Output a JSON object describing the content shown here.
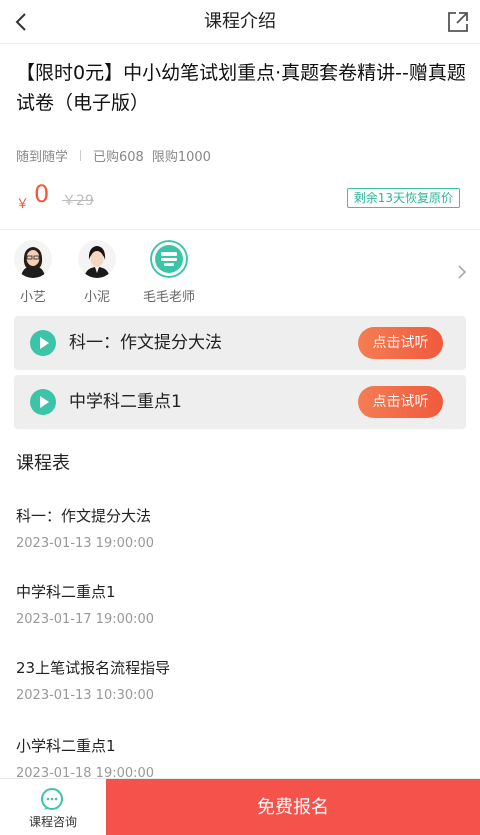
{
  "header": {
    "title": "课程介绍",
    "back_icon": "chevron-left-icon",
    "share_icon": "share-icon"
  },
  "course": {
    "title": "【限时0元】中小幼笔试划重点·真题套卷精讲--赠真题试卷（电子版）",
    "mode": "随到随学",
    "purchased": "已购608",
    "limit": "限购1000",
    "currency": "￥",
    "price": "0",
    "original_price": "￥29",
    "restore_badge": "剩余13天恢复原价"
  },
  "teachers": [
    {
      "name": "小艺"
    },
    {
      "name": "小泥"
    },
    {
      "name": "毛毛老师"
    }
  ],
  "trials": [
    {
      "label": "科一：作文提分大法",
      "button": "点击试听"
    },
    {
      "label": "中学科二重点1",
      "button": "点击试听"
    }
  ],
  "schedule": {
    "heading": "课程表",
    "items": [
      {
        "name": "科一：作文提分大法",
        "time": "2023-01-13 19:00:00"
      },
      {
        "name": "中学科二重点1",
        "time": "2023-01-17 19:00:00"
      },
      {
        "name": "23上笔试报名流程指导",
        "time": "2023-01-13 10:30:00"
      },
      {
        "name": "小学科二重点1",
        "time": "2023-01-18 19:00:00"
      }
    ]
  },
  "bottom": {
    "consult_label": "课程咨询",
    "signup_label": "免费报名"
  },
  "colors": {
    "accent_red": "#f05a3c",
    "accent_green": "#3cc4a9",
    "signup_bg": "#f5524c"
  }
}
